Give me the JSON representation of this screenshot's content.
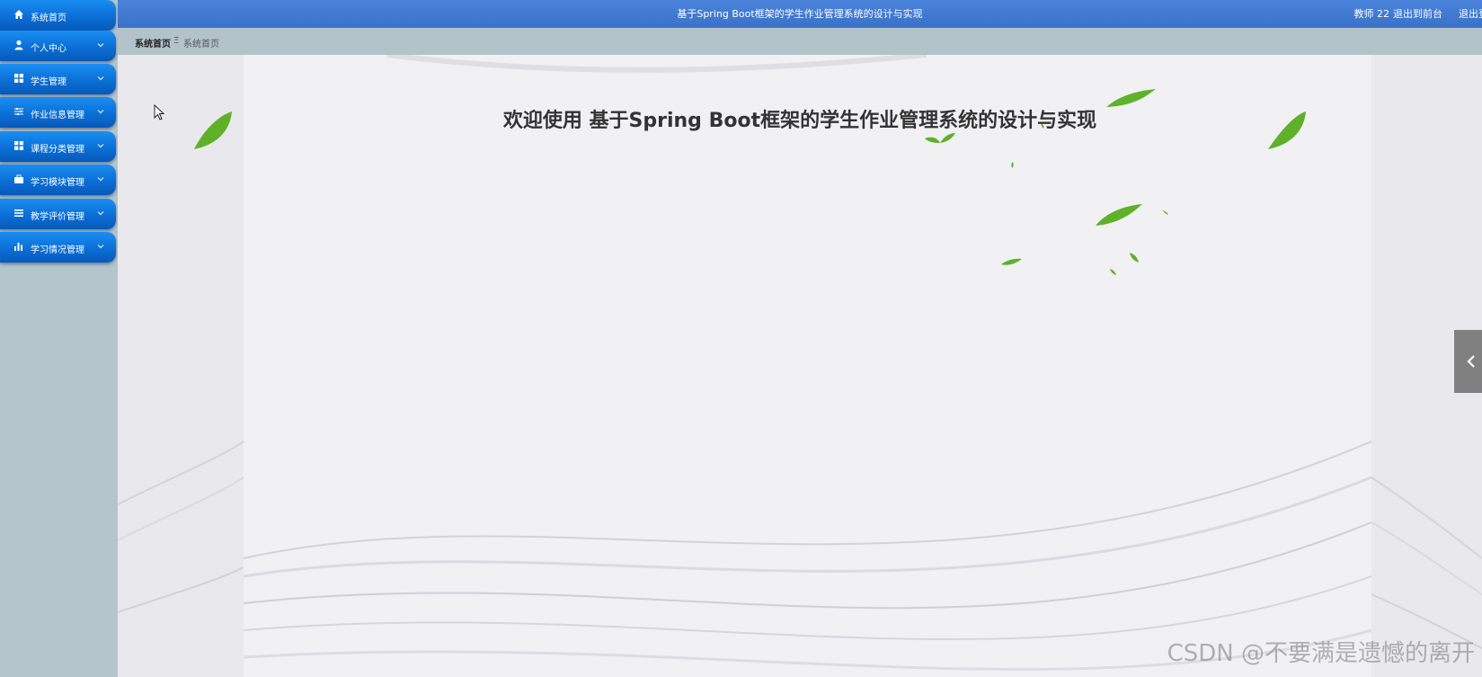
{
  "sidebar": {
    "items": [
      {
        "label": "系统首页",
        "icon": "home-icon",
        "has_chevron": false
      },
      {
        "label": "个人中心",
        "icon": "user-icon",
        "has_chevron": true
      },
      {
        "label": "学生管理",
        "icon": "grid-icon",
        "has_chevron": true
      },
      {
        "label": "作业信息管理",
        "icon": "sliders-icon",
        "has_chevron": true
      },
      {
        "label": "课程分类管理",
        "icon": "grid-icon",
        "has_chevron": true
      },
      {
        "label": "学习模块管理",
        "icon": "briefcase-icon",
        "has_chevron": true
      },
      {
        "label": "教学评价管理",
        "icon": "list-icon",
        "has_chevron": true
      },
      {
        "label": "学习情况管理",
        "icon": "bar-chart-icon",
        "has_chevron": true
      }
    ]
  },
  "header": {
    "title": "基于Spring Boot框架的学生作业管理系统的设计与实现",
    "user": "教师 22",
    "frontend_link": "退出到前台",
    "logout_link": "退出登录"
  },
  "breadcrumb": {
    "home": "系统首页",
    "separator": "Ξ",
    "current": "系统首页"
  },
  "main": {
    "welcome": "欢迎使用 基于Spring Boot框架的学生作业管理系统的设计与实现"
  },
  "watermark": "CSDN @不要满是遗憾的离开",
  "colors": {
    "nav_blue": "#0b6fd6",
    "header_blue": "#3f77cf",
    "sidebar_bg": "#b4c5cc",
    "leaf_green": "#5fb12a"
  }
}
